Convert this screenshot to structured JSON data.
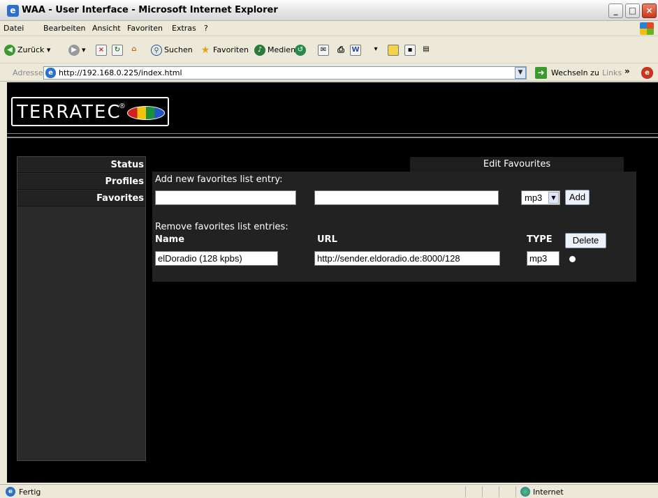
{
  "window": {
    "title": "WAA - User Interface - Microsoft Internet Explorer"
  },
  "menu": [
    "Datei",
    "Bearbeiten",
    "Ansicht",
    "Favoriten",
    "Extras",
    "?"
  ],
  "toolbar": {
    "back": "Zurück",
    "search": "Suchen",
    "favorites": "Favoriten",
    "media": "Medien"
  },
  "address": {
    "label": "Adresse",
    "url": "http://192.168.0.225/index.html",
    "go": "Wechseln zu",
    "links": "Links"
  },
  "logo": {
    "text": "TERRATEC",
    "reg": "®"
  },
  "nav": [
    {
      "label": "Status"
    },
    {
      "label": "Profiles"
    },
    {
      "label": "Favorites"
    }
  ],
  "panel": {
    "header": "Edit Favourites",
    "add_heading": "Add new favorites list entry:",
    "add_name": "",
    "add_url": "",
    "add_type": "mp3",
    "add_button": "Add",
    "remove_heading": "Remove favorites list entries:",
    "col_name": "Name",
    "col_url": "URL",
    "col_type": "TYPE",
    "delete_button": "Delete",
    "entries": [
      {
        "name": "elDoradio (128 kpbs)",
        "url": "http://sender.eldoradio.de:8000/128",
        "type": "mp3"
      }
    ]
  },
  "status": {
    "text": "Fertig",
    "zone": "Internet"
  }
}
